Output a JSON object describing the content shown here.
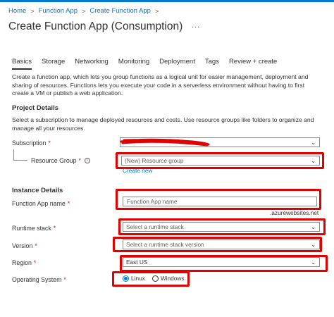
{
  "breadcrumb": {
    "items": [
      "Home",
      "Function App",
      "Create Function App"
    ],
    "separator": ">"
  },
  "page": {
    "title": "Create Function App (Consumption)",
    "more": "..."
  },
  "tabs": [
    {
      "label": "Basics",
      "active": true
    },
    {
      "label": "Storage",
      "active": false
    },
    {
      "label": "Networking",
      "active": false
    },
    {
      "label": "Monitoring",
      "active": false
    },
    {
      "label": "Deployment",
      "active": false
    },
    {
      "label": "Tags",
      "active": false
    },
    {
      "label": "Review + create",
      "active": false
    }
  ],
  "intro": "Create a function app, which lets you group functions as a logical unit for easier management, deployment and sharing of resources. Functions lets you execute your code in a serverless environment without having to first create a VM or publish a web application.",
  "project": {
    "heading": "Project Details",
    "description": "Select a subscription to manage deployed resources and costs. Use resource groups like folders to organize and manage all your resources.",
    "subscription": {
      "label": "Subscription",
      "required": "*",
      "value": ""
    },
    "resource_group": {
      "label": "Resource Group",
      "required": "*",
      "value": "(New) Resource group",
      "create_new": "Create new"
    }
  },
  "instance": {
    "heading": "Instance Details",
    "app_name": {
      "label": "Function App name",
      "required": "*",
      "placeholder": "Function App name",
      "suffix": ".azurewebsites.net"
    },
    "runtime": {
      "label": "Runtime stack",
      "required": "*",
      "value": "Select a runtime stack"
    },
    "version": {
      "label": "Version",
      "required": "*",
      "value": "Select a runtime stack version"
    },
    "region": {
      "label": "Region",
      "required": "*",
      "value": "East US"
    },
    "os": {
      "label": "Operating System",
      "required": "*",
      "options": [
        "Linux",
        "Windows"
      ],
      "selected": "Linux"
    }
  },
  "icons": {
    "chevron": "chevron-down-icon",
    "info": "info-icon"
  },
  "colors": {
    "accent": "#0078d4",
    "highlight": "#e00000",
    "required": "#a4262c"
  }
}
